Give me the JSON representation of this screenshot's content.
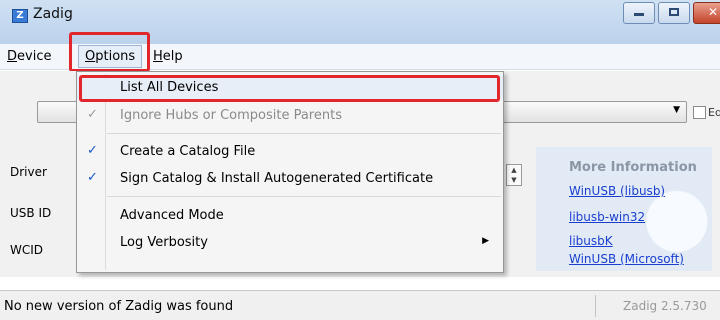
{
  "window": {
    "title": "Zadig",
    "app_icon_glyph": "Z"
  },
  "menu": {
    "device": {
      "underline": "D",
      "rest": "evice"
    },
    "options": {
      "underline": "O",
      "rest": "ptions"
    },
    "help": {
      "underline": "H",
      "rest": "elp"
    }
  },
  "dropdown": {
    "items": [
      {
        "label": "List All Devices",
        "checked": false
      },
      {
        "label": "Ignore Hubs or Composite Parents",
        "checked": true,
        "check_glyph": "✓",
        "disabled": true
      },
      {
        "label": "Create a Catalog File",
        "checked": true,
        "check_glyph": "✓"
      },
      {
        "label": "Sign Catalog & Install Autogenerated Certificate",
        "checked": true,
        "check_glyph": "✓"
      },
      {
        "label": "Advanced Mode",
        "checked": false
      },
      {
        "label": "Log Verbosity",
        "checked": false,
        "submenu_glyph": "▶"
      }
    ]
  },
  "main": {
    "edit_label": "Edit",
    "combo_arrow": "▼",
    "labels": {
      "driver": "Driver",
      "usb_id": "USB ID",
      "wcid": "WCID"
    }
  },
  "info": {
    "title": "More Information",
    "links": [
      "WinUSB (libusb)",
      "libusb-win32",
      "libusbK",
      "WinUSB (Microsoft)"
    ]
  },
  "status": {
    "message": "No new version of Zadig was found",
    "version": "Zadig 2.5.730"
  },
  "colors": {
    "highlight": "#e1262c",
    "link": "#1a3fcf"
  }
}
